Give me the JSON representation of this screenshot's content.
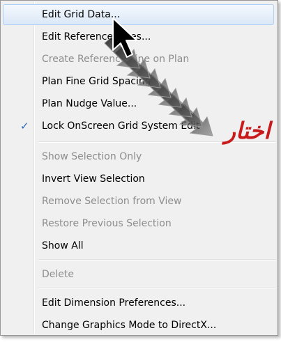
{
  "menu": {
    "items": [
      {
        "label": "Edit Grid Data...",
        "enabled": true,
        "highlighted": true
      },
      {
        "label": "Edit Reference Lines...",
        "enabled": true
      },
      {
        "label": "Create Reference Line on Plan",
        "enabled": false
      },
      {
        "label": "Plan Fine Grid Spacing...",
        "enabled": true
      },
      {
        "label": "Plan Nudge Value...",
        "enabled": true
      },
      {
        "label": "Lock OnScreen Grid System Edit",
        "enabled": true,
        "checked": true,
        "check_mark": "✓"
      },
      {
        "label": "Show Selection Only",
        "enabled": false
      },
      {
        "label": "Invert View Selection",
        "enabled": true
      },
      {
        "label": "Remove Selection from View",
        "enabled": false
      },
      {
        "label": "Restore Previous Selection",
        "enabled": false
      },
      {
        "label": "Show All",
        "enabled": true
      },
      {
        "label": "Delete",
        "enabled": false
      },
      {
        "label": "Edit Dimension Preferences...",
        "enabled": true
      },
      {
        "label": "Change Graphics Mode to DirectX...",
        "enabled": true
      }
    ]
  },
  "annotation": {
    "text": "اختار",
    "color": "#c8191b"
  },
  "colors": {
    "highlight_border": "#aecff7",
    "disabled_text": "#8d8d8d",
    "check": "#2c68b4"
  },
  "icons": {
    "pointer": "mouse-pointer-icon",
    "check": "check-mark-icon"
  }
}
